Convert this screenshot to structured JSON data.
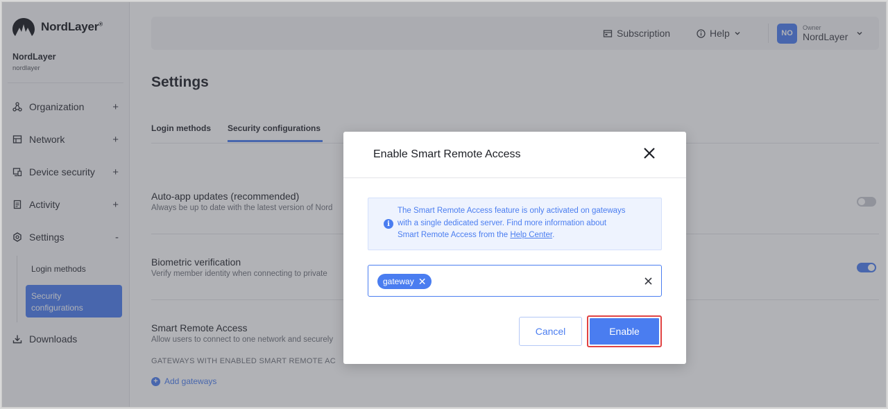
{
  "brand": {
    "name": "NordLayer",
    "trademark": "®"
  },
  "organization": {
    "name": "NordLayer",
    "slug": "nordlayer"
  },
  "sidebar": {
    "items": [
      {
        "label": "Organization",
        "icon": "organization-icon",
        "toggle": "+"
      },
      {
        "label": "Network",
        "icon": "network-icon",
        "toggle": "+"
      },
      {
        "label": "Device security",
        "icon": "device-security-icon",
        "toggle": "+"
      },
      {
        "label": "Activity",
        "icon": "activity-icon",
        "toggle": "+"
      },
      {
        "label": "Settings",
        "icon": "settings-icon",
        "toggle": "-"
      },
      {
        "label": "Downloads",
        "icon": "download-icon"
      }
    ],
    "settings_sub": {
      "login_methods": "Login methods",
      "security_configurations_line1": "Security",
      "security_configurations_line2": "configurations"
    }
  },
  "topbar": {
    "subscription": "Subscription",
    "help": "Help",
    "avatar_initials": "NO",
    "user_role": "Owner",
    "user_name": "NordLayer"
  },
  "page": {
    "title": "Settings",
    "tabs": [
      {
        "label": "Login methods",
        "active": false
      },
      {
        "label": "Security configurations",
        "active": true
      }
    ],
    "rows": [
      {
        "title": "Auto-app updates (recommended)",
        "desc": "Always be up to date with the latest version of Nord",
        "toggle_on": false
      },
      {
        "title": "Biometric verification",
        "desc": "Verify member identity when connecting to private",
        "toggle_on": true
      },
      {
        "title": "Smart Remote Access",
        "desc": "Allow users to connect to one network and securely"
      }
    ],
    "gateways_heading": "GATEWAYS WITH ENABLED SMART REMOTE AC",
    "add_gateways": "Add gateways"
  },
  "modal": {
    "title": "Enable Smart Remote Access",
    "info_line1": "The Smart Remote Access feature is only activated on gateways",
    "info_line2": "with a single dedicated server. Find more information about",
    "info_line3_pre": "Smart Remote Access from the ",
    "info_link": "Help Center",
    "info_line3_post": ".",
    "chip": "gateway",
    "cancel": "Cancel",
    "enable": "Enable"
  },
  "colors": {
    "accent": "#4a7df0",
    "highlight": "#e04343",
    "overlay": "#46484f"
  }
}
